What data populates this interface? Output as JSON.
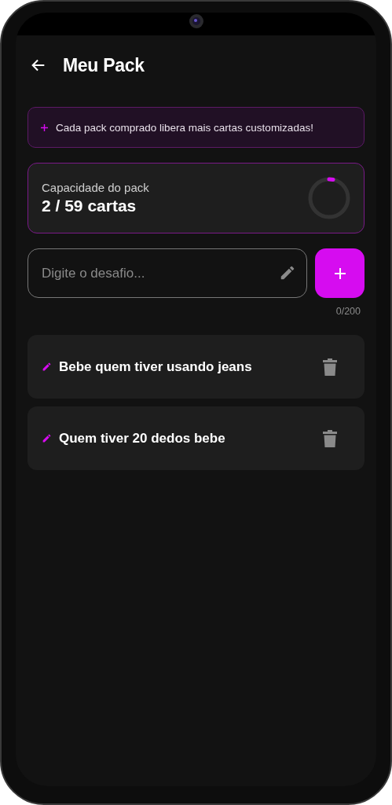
{
  "header": {
    "title": "Meu Pack"
  },
  "banner": {
    "text": "Cada pack comprado libera mais cartas customizadas!"
  },
  "capacity": {
    "label": "Capacidade do pack",
    "value": "2 / 59 cartas",
    "level": 0.034
  },
  "input": {
    "placeholder": "Digite o desafio...",
    "counter": "0/200"
  },
  "cards": [
    {
      "text": "Bebe quem tiver usando jeans"
    },
    {
      "text": "Quem tiver 20 dedos bebe"
    }
  ]
}
